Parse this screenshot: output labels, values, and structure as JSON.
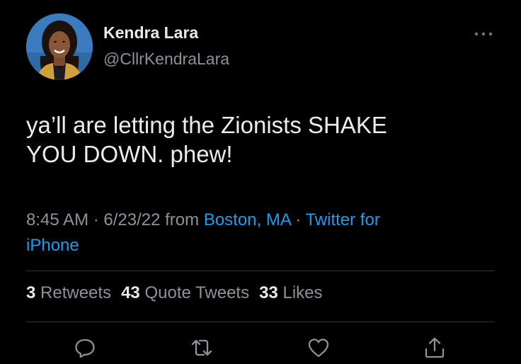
{
  "tweet": {
    "author_name": "Kendra Lara",
    "author_handle": "@CllrKendraLara",
    "text_line1": "ya’ll are letting the Zionists SHAKE",
    "text_line2": "YOU DOWN. phew!",
    "time": "8:45 AM",
    "dot1": " · ",
    "date": "6/23/22",
    "from_label": " from ",
    "location": "Boston, MA",
    "dot2": " · ",
    "source_line1": "Twitter for",
    "source_line2": "iPhone"
  },
  "stats": {
    "retweets_count": "3",
    "retweets_label": "Retweets",
    "quotes_count": "43",
    "quotes_label": "Quote Tweets",
    "likes_count": "33",
    "likes_label": "Likes"
  },
  "actions": [
    {
      "icon": "reply-icon"
    },
    {
      "icon": "retweet-icon"
    },
    {
      "icon": "like-icon"
    },
    {
      "icon": "share-icon"
    }
  ],
  "colors": {
    "background": "#000000",
    "text_primary": "#e7e9ea",
    "text_secondary": "#8b9299",
    "link": "#1d9bf0",
    "divider": "#2f3336"
  }
}
